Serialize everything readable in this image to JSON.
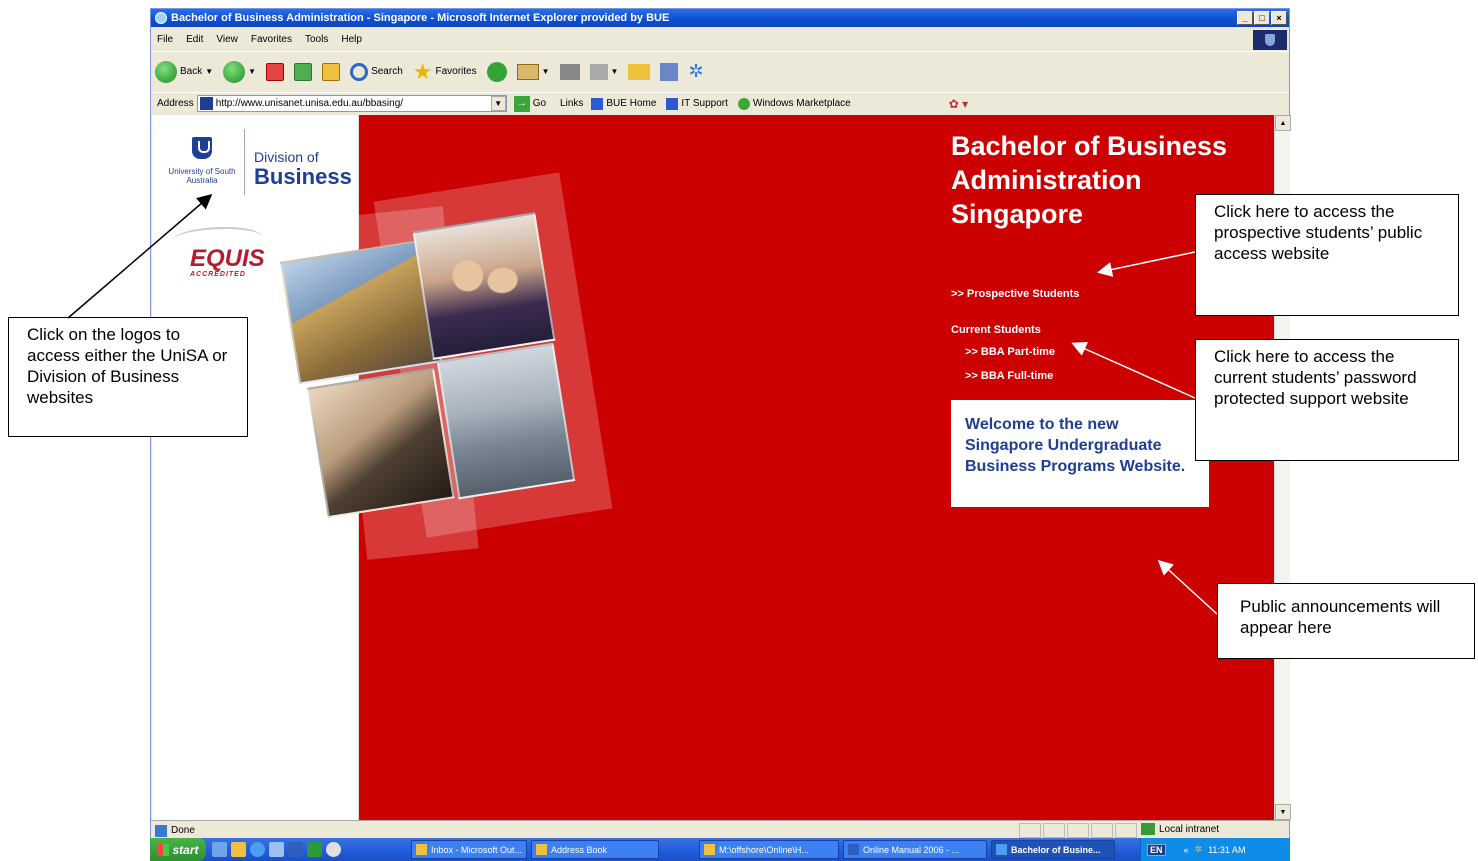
{
  "window": {
    "title": "Bachelor of Business Administration - Singapore - Microsoft Internet Explorer provided by BUE",
    "minimize": "_",
    "maximize": "□",
    "close": "×"
  },
  "menu": [
    "File",
    "Edit",
    "View",
    "Favorites",
    "Tools",
    "Help"
  ],
  "toolbar": {
    "back": "Back",
    "search": "Search",
    "favorites": "Favorites"
  },
  "address": {
    "label": "Address",
    "url": "http://www.unisanet.unisa.edu.au/bbasing/",
    "go": "Go",
    "links_label": "Links",
    "links": [
      "BUE Home",
      "IT Support",
      "Windows Marketplace"
    ]
  },
  "page": {
    "unisa_text": "University of South Australia",
    "division_of": "Division of",
    "division_business": "Business",
    "equis": "EQUIS",
    "equis_sub": "ACCREDITED",
    "title": "Bachelor of Business Administration Singapore",
    "prospective": ">> Prospective Students",
    "current_heading": "Current Students",
    "part_time": ">> BBA Part-time",
    "full_time": ">> BBA Full-time",
    "welcome": "Welcome to the new Singapore Undergraduate Business Programs Website."
  },
  "status": {
    "text": "Done",
    "zone": "Local intranet"
  },
  "taskbar": {
    "start": "start",
    "tasks": [
      "Inbox - Microsoft Out...",
      "Address Book",
      "M:\\offshore\\Online\\H...",
      "Online Manual 2006 - ...",
      "Bachelor of Busine..."
    ],
    "lang": "EN",
    "tray_chevron": "«",
    "clock": "11:31 AM"
  },
  "callouts": {
    "logos": "Click on the logos to access either the UniSA or Division of Business websites",
    "prospective": "Click here to access the prospective students’ public access website",
    "current": "Click here to access the current students’ password protected support website",
    "announcements": "Public announcements will appear here"
  },
  "colors": {
    "page_red": "#cc0000",
    "unisa_blue": "#1f3f94",
    "equis_red": "#b51d2c"
  }
}
